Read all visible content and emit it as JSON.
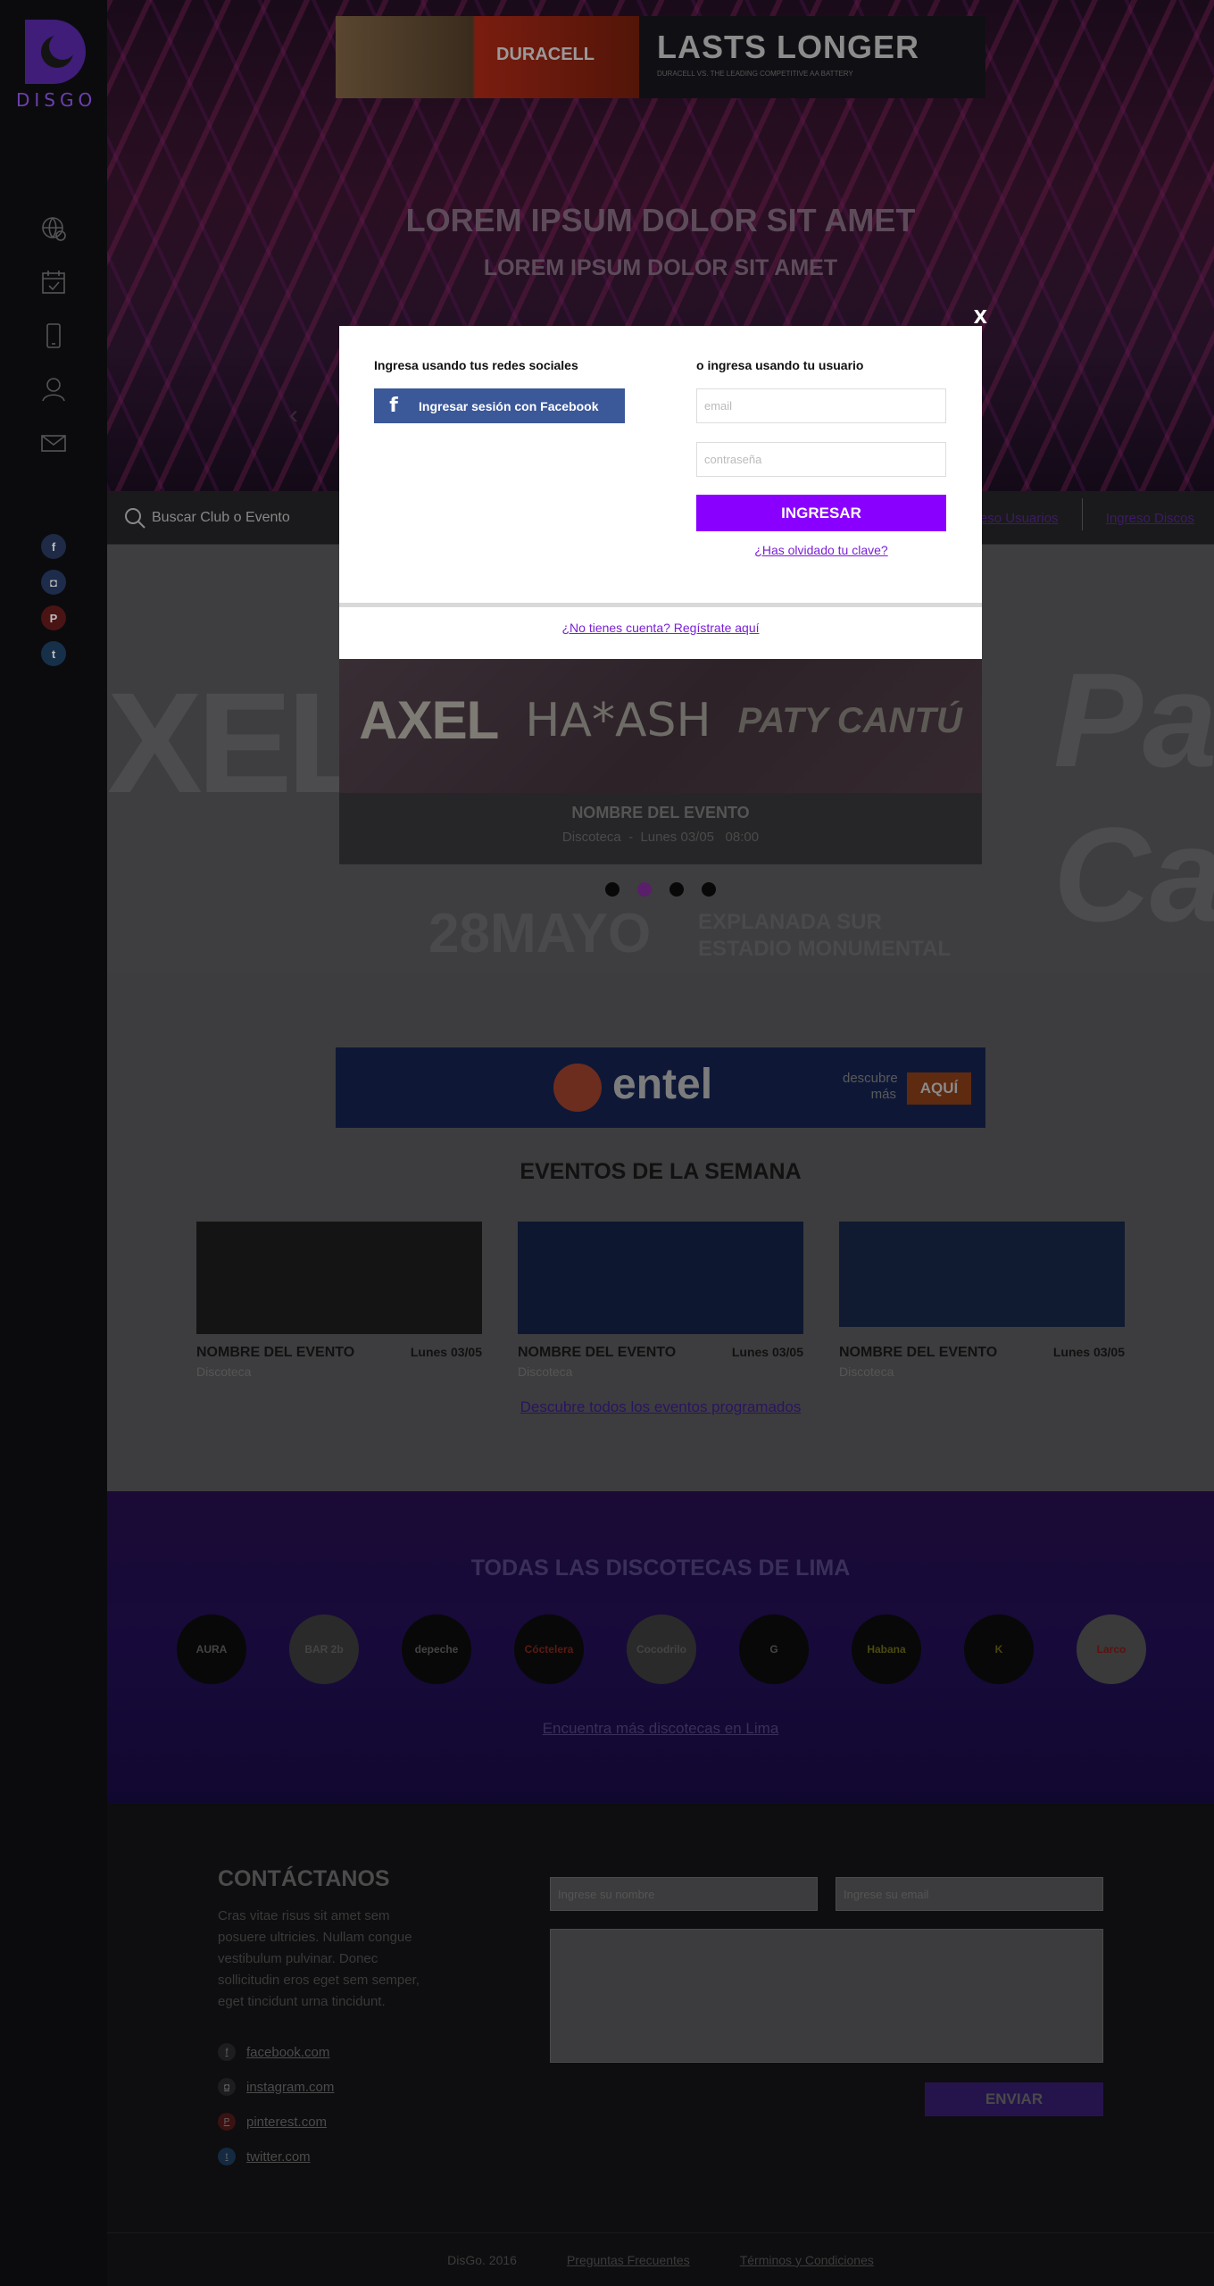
{
  "brand": {
    "logo_text": "DISGO"
  },
  "colors": {
    "accent": "#8a00ff",
    "facebook": "#3b5899",
    "background": "#0b0b0d"
  },
  "sidebar": {
    "nav_icons": [
      "globe-icon",
      "calendar-icon",
      "phone-icon",
      "user-icon",
      "mail-icon"
    ],
    "social": [
      {
        "icon": "facebook-icon",
        "glyph": "f"
      },
      {
        "icon": "instagram-icon",
        "glyph": "◘"
      },
      {
        "icon": "pinterest-icon",
        "glyph": "P"
      },
      {
        "icon": "twitter-icon",
        "glyph": "t"
      }
    ]
  },
  "top_ad": {
    "brand": "DURACELL",
    "headline": "LASTS LONGER",
    "fine_print": "DURACELL VS. THE LEADING COMPETITIVE AA BATTERY"
  },
  "hero": {
    "title": "LOREM IPSUM DOLOR SIT AMET",
    "subtitle": "LOREM IPSUM DOLOR SIT AMET"
  },
  "search": {
    "placeholder": "Buscar Club o Evento"
  },
  "login_links": {
    "users": "Ingreso Usuarios",
    "clubs": "Ingreso Discos"
  },
  "carousel": {
    "artists": [
      "AXEL",
      "HA*ASH",
      "PATY CANTÚ"
    ],
    "ghost_left": "XEL",
    "ghost_right": "Pa Ca",
    "ghost_date": "28MAYO",
    "ghost_place_1": "EXPLANADA SUR",
    "ghost_place_2": "ESTADIO MONUMENTAL",
    "event_name": "NOMBRE DEL EVENTO",
    "event_type": "Discoteca",
    "event_date": "Lunes 03/05",
    "event_time": "08:00",
    "slide_count": 4,
    "active_slide": 2
  },
  "mid_ad": {
    "brand": "entel",
    "description": "descubre más",
    "cta": "AQUÍ"
  },
  "week_events": {
    "title": "EVENTOS DE LA SEMANA",
    "items": [
      {
        "name": "NOMBRE DEL EVENTO",
        "date": "Lunes 03/05",
        "type": "Discoteca"
      },
      {
        "name": "NOMBRE DEL EVENTO",
        "date": "Lunes 03/05",
        "type": "Discoteca"
      },
      {
        "name": "NOMBRE DEL EVENTO",
        "date": "Lunes 03/05",
        "type": "Discoteca"
      }
    ],
    "more_link": "Descubre  todos los eventos programados"
  },
  "clubs": {
    "title": "TODAS LAS DISCOTECAS DE LIMA",
    "logos": [
      "AURA",
      "BAR 2b",
      "depeche",
      "Cóctelera",
      "Cocodrilo",
      "G",
      "Habana",
      "K",
      "Larco"
    ],
    "more_link": "Encuentra más discotecas en Lima"
  },
  "contact": {
    "title": "CONTÁCTANOS",
    "text": "Cras vitae risus sit amet sem posuere ultricies. Nullam congue vestibulum pulvinar. Donec sollicitudin eros eget sem semper, eget tincidunt urna tincidunt.",
    "links": [
      {
        "icon": "facebook-icon",
        "label": "facebook.com"
      },
      {
        "icon": "instagram-icon",
        "label": "instagram.com"
      },
      {
        "icon": "pinterest-icon",
        "label": "pinterest.com"
      },
      {
        "icon": "twitter-icon",
        "label": "twitter.com"
      }
    ],
    "name_placeholder": "Ingrese su nombre",
    "email_placeholder": "Ingrese su email",
    "send_label": "ENVIAR"
  },
  "footer": {
    "copyright": "DisGo. 2016",
    "faq": "Preguntas Frecuentes",
    "terms": "Términos y Condiciones"
  },
  "modal": {
    "close": "X",
    "social_heading": "Ingresa usando tus redes sociales",
    "facebook_button": "Ingresar sesión con Facebook",
    "user_heading": "o ingresa usando tu usuario",
    "email_placeholder": "email",
    "password_placeholder": "contraseña",
    "submit": "INGRESAR",
    "forgot": "¿Has olvidado tu clave?",
    "signup": "¿No tienes cuenta? Regístrate aquí"
  }
}
